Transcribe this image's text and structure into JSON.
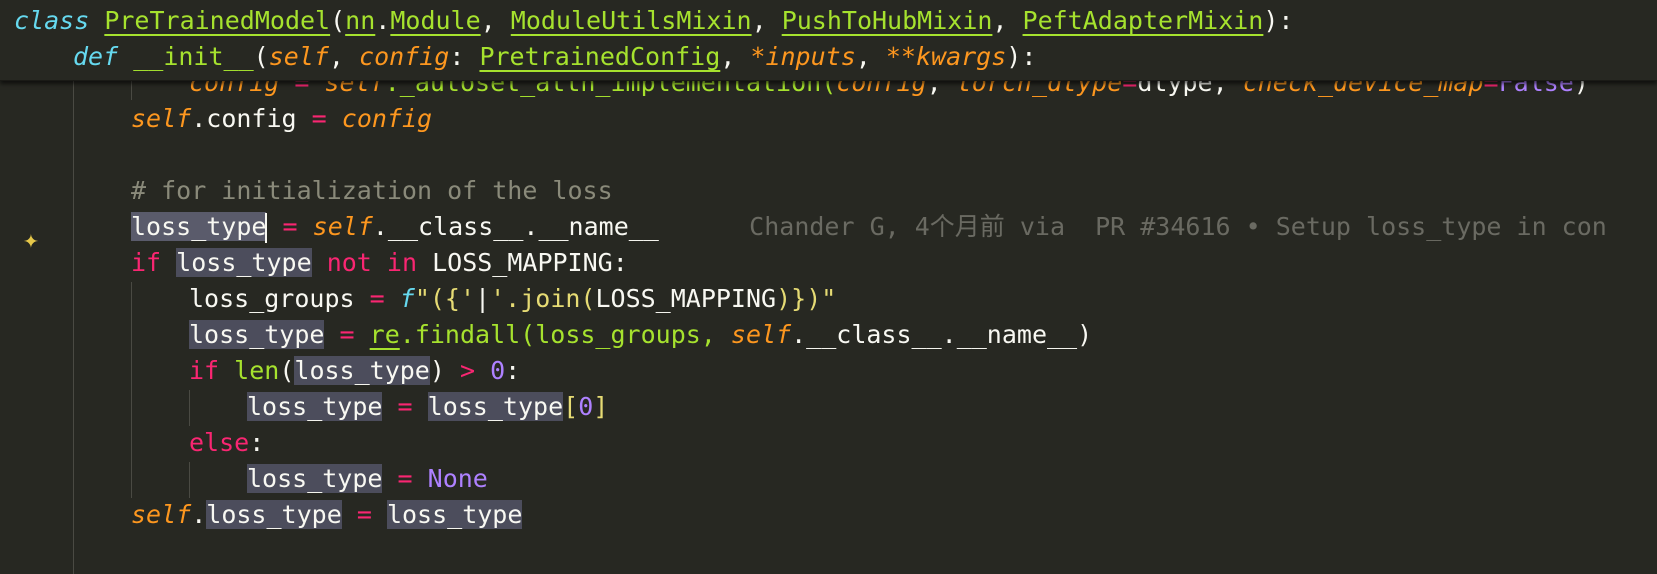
{
  "sticky_scroll": {
    "line1": {
      "kw_class": "class",
      "class_name": "PreTrainedModel",
      "base1_mod": "nn",
      "base1_name": "Module",
      "base2": "ModuleUtilsMixin",
      "base3": "PushToHubMixin",
      "base4": "PeftAdapterMixin"
    },
    "line2": {
      "kw_def": "def",
      "fn_name": "__init__",
      "p_self": "self",
      "p_config": "config",
      "type_config": "PretrainedConfig",
      "p_inputs": "*inputs",
      "p_kwargs": "**kwargs"
    }
  },
  "partial_line": {
    "text_config": "config",
    "text_self": "self",
    "text_method": "._autoset_attn_implementation(",
    "arg1": "config",
    "arg2_name": "torch_dtype",
    "arg2_val": "dtype",
    "arg3_name": "check_device_map",
    "arg3_val": "False"
  },
  "code": {
    "l1_self": "self",
    "l1_attr": ".config",
    "l1_val": "config",
    "comment": "# for initialization of the loss",
    "l4_var": "loss_type",
    "l4_self": "self",
    "l4_rest": ".__class__.__name__",
    "blame": "Chander G, 4个月前 via  PR #34616 • Setup loss_type in con",
    "l5_if": "if",
    "l5_var": "loss_type",
    "l5_not": "not",
    "l5_in": "in",
    "l5_const": "LOSS_MAPPING:",
    "l6_var": "loss_groups",
    "l6_f": "f",
    "l6_str_a": "\"({'",
    "l6_pipe": "|",
    "l6_str_b": "'.join(",
    "l6_inner": "LOSS_MAPPING",
    "l6_str_c": ")})\"",
    "l7_var": "loss_type",
    "l7_re": "re",
    "l7_call": ".findall(loss_groups, ",
    "l7_self": "self",
    "l7_rest": ".__class__.__name__)",
    "l8_if": "if",
    "l8_len": "len",
    "l8_var": "loss_type",
    "l8_zero": "0",
    "l9_var": "loss_type",
    "l9_val": "loss_type",
    "l9_idx": "0",
    "l10_else": "else",
    "l11_var": "loss_type",
    "l11_none": "None",
    "l12_self": "self",
    "l12_attr": "loss_type",
    "l12_val": "loss_type"
  }
}
